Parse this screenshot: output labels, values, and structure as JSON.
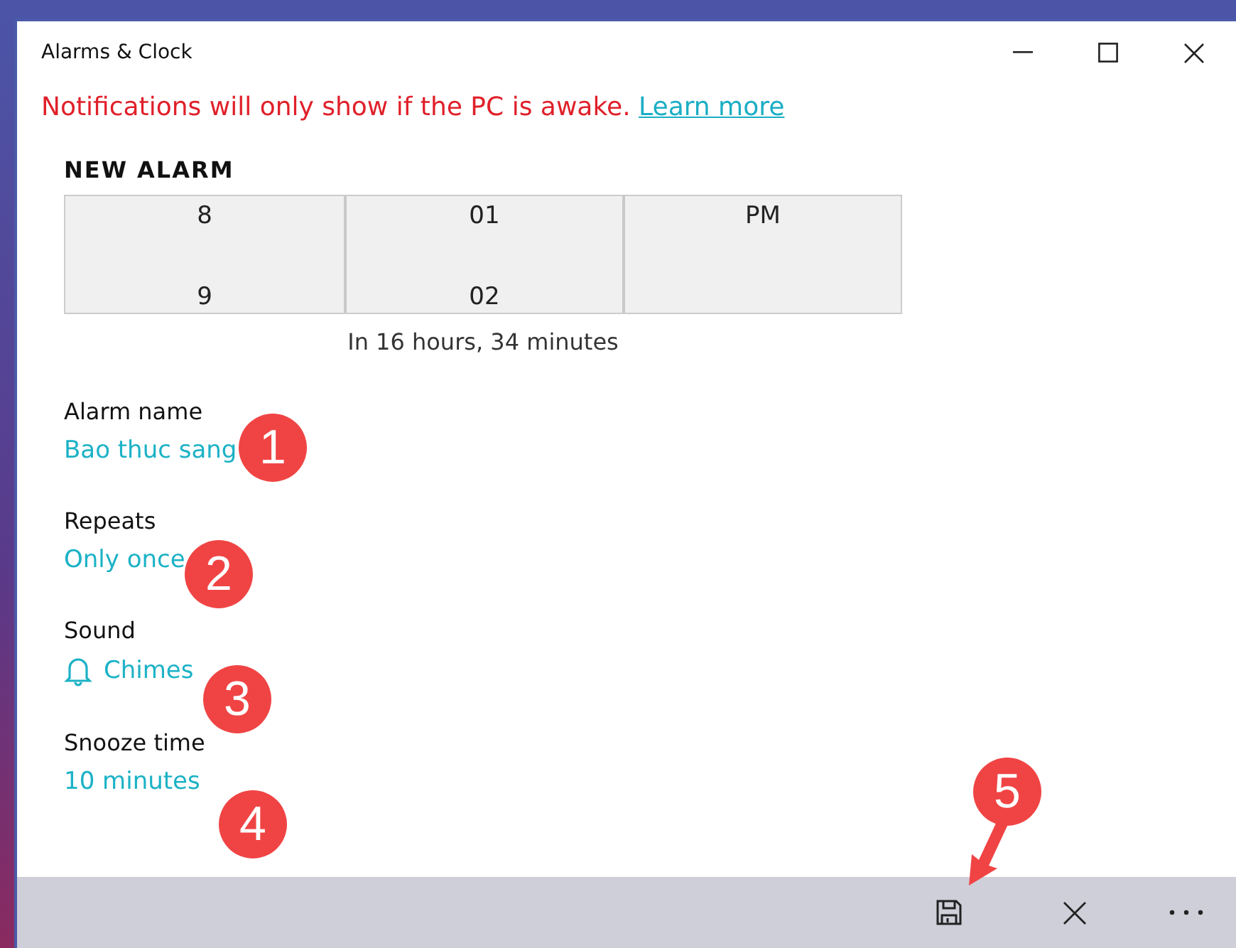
{
  "window": {
    "title": "Alarms & Clock"
  },
  "notice": {
    "text": "Notifications will only show if the PC is awake.",
    "link": "Learn more"
  },
  "heading": "NEW ALARM",
  "time_picker": {
    "columns": [
      {
        "values": [
          "8",
          "9"
        ]
      },
      {
        "values": [
          "01",
          "02"
        ]
      },
      {
        "values": [
          "PM"
        ]
      }
    ],
    "caption": "In 16 hours, 34 minutes"
  },
  "settings": [
    {
      "kind": "text",
      "label": "Alarm name",
      "value": "Bao thuc sang",
      "badge": "1"
    },
    {
      "kind": "text",
      "label": "Repeats",
      "value": "Only once",
      "badge": "2"
    },
    {
      "kind": "sound",
      "label": "Sound",
      "value": "Chimes",
      "badge": "3"
    },
    {
      "kind": "text",
      "label": "Snooze time",
      "value": "10 minutes",
      "badge": "4"
    }
  ],
  "command_bar": {
    "buttons": [
      {
        "kind": "save",
        "badge": "5"
      },
      {
        "kind": "close"
      },
      {
        "kind": "more"
      }
    ]
  }
}
